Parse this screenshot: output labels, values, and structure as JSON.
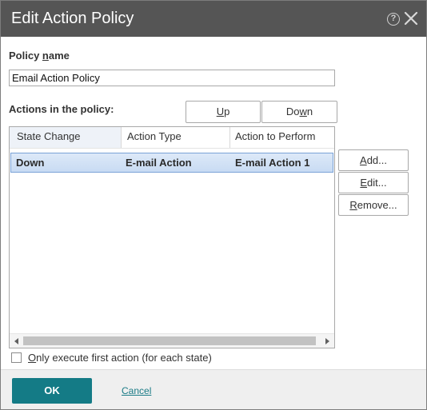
{
  "dialog": {
    "title": "Edit Action Policy",
    "help_icon": "help-circle-icon",
    "close_icon": "close-icon"
  },
  "policy_name": {
    "label_pre": "Policy ",
    "label_u": "n",
    "label_post": "ame",
    "value": "Email Action Policy"
  },
  "actions": {
    "label": "Actions in the policy:",
    "up_pre": "",
    "up_u": "U",
    "up_post": "p",
    "down_pre": "Do",
    "down_u": "w",
    "down_post": "n",
    "columns": [
      "State Change",
      "Action Type",
      "Action to Perform"
    ],
    "rows": [
      {
        "state": "Down",
        "type": "E-mail Action",
        "perform": "E-mail Action 1"
      }
    ],
    "add_pre": "",
    "add_u": "A",
    "add_post": "dd...",
    "edit_pre": "",
    "edit_u": "E",
    "edit_post": "dit...",
    "remove_pre": "",
    "remove_u": "R",
    "remove_post": "emove..."
  },
  "only_first": {
    "label_pre": "",
    "label_u": "O",
    "label_post": "nly execute first action (for each state)",
    "checked": false
  },
  "footer": {
    "ok_label": "OK",
    "cancel_label": "Cancel"
  },
  "colors": {
    "titlebar": "#555555",
    "ok_button": "#147b86",
    "selected_row": "#c8dbf3"
  }
}
